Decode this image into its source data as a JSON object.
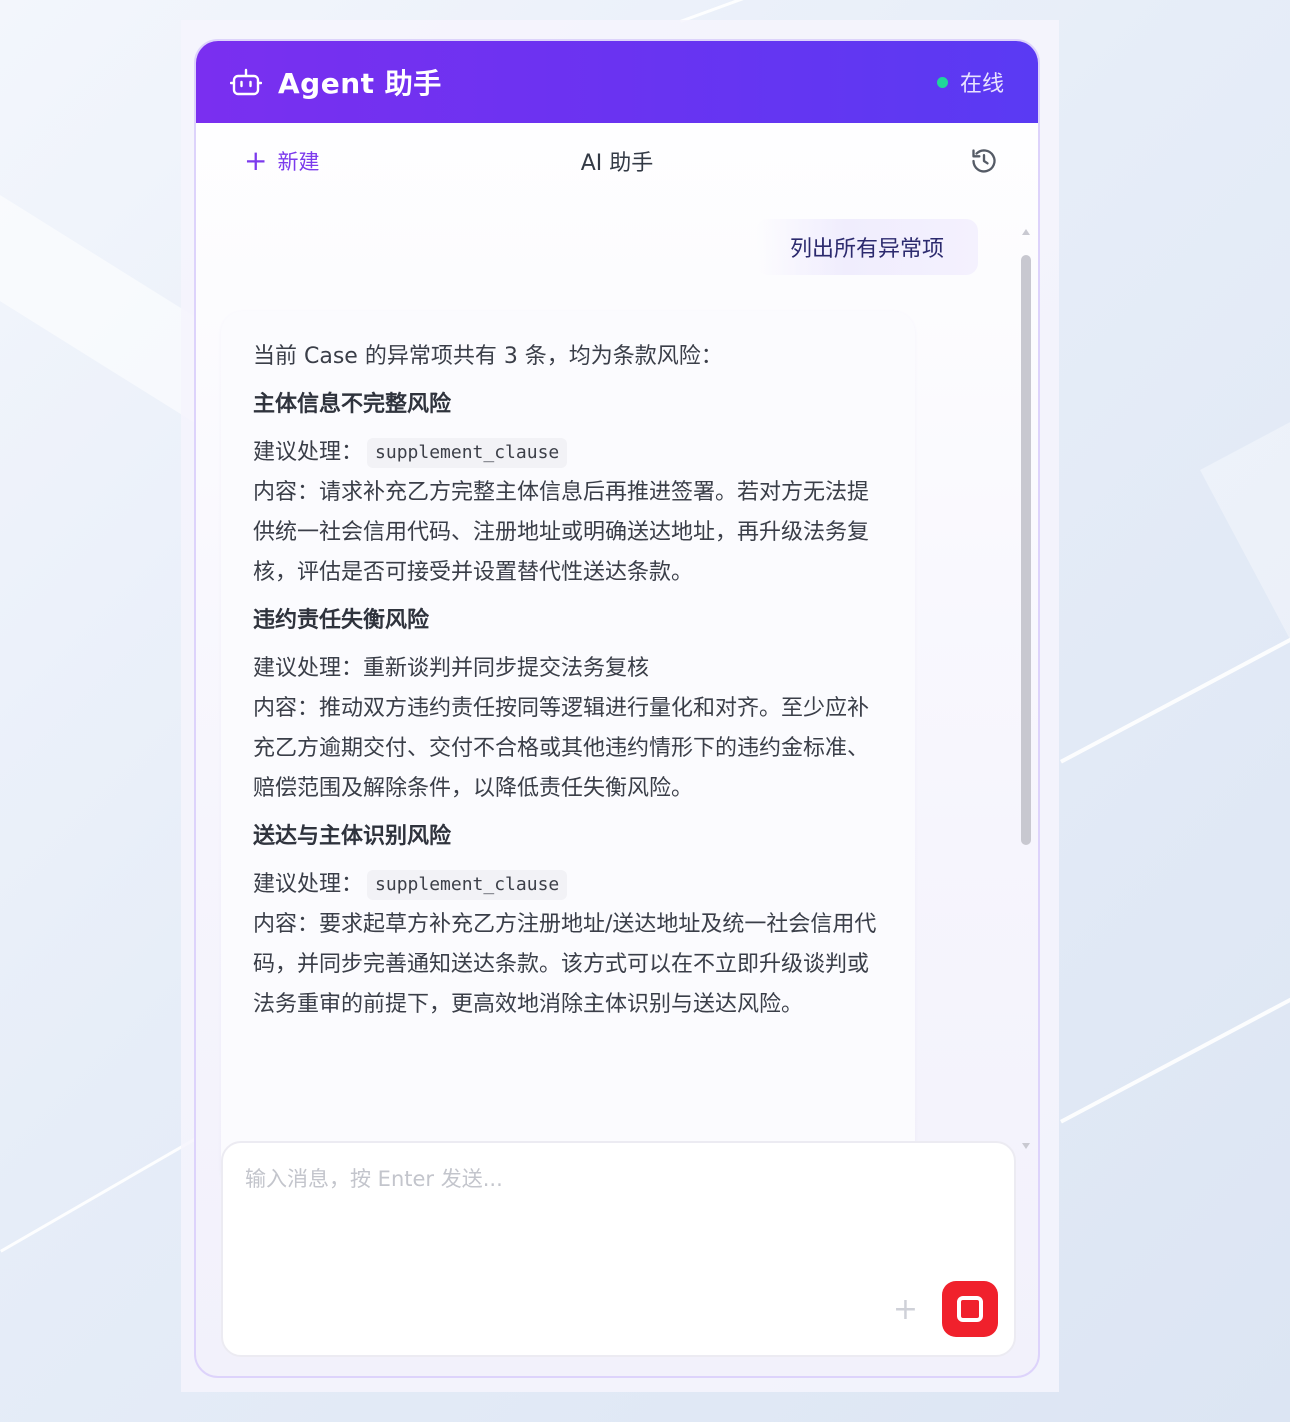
{
  "header": {
    "title": "Agent 助手",
    "status": "在线",
    "status_color": "#20d59a"
  },
  "toolbar": {
    "new_label": "新建",
    "center_title": "AI 助手"
  },
  "user_message": "列出所有异常项",
  "assistant": {
    "intro": "当前 Case 的异常项共有 3 条，均为条款风险：",
    "items": [
      {
        "title": "主体信息不完整风险",
        "suggest_label": "建议处理：",
        "suggest_code": "supplement_clause",
        "suggest_text": "",
        "content": "内容：请求补充乙方完整主体信息后再推进签署。若对方无法提供统一社会信用代码、注册地址或明确送达地址，再升级法务复核，评估是否可接受并设置替代性送达条款。"
      },
      {
        "title": "违约责任失衡风险",
        "suggest_label": "建议处理：",
        "suggest_code": "",
        "suggest_text": "重新谈判并同步提交法务复核",
        "content": "内容：推动双方违约责任按同等逻辑进行量化和对齐。至少应补充乙方逾期交付、交付不合格或其他违约情形下的违约金标准、赔偿范围及解除条件，以降低责任失衡风险。"
      },
      {
        "title": "送达与主体识别风险",
        "suggest_label": "建议处理：",
        "suggest_code": "supplement_clause",
        "suggest_text": "",
        "content": "内容：要求起草方补充乙方注册地址/送达地址及统一社会信用代码，并同步完善通知送达条款。该方式可以在不立即升级谈判或法务重审的前提下，更高效地消除主体识别与送达风险。"
      }
    ]
  },
  "composer": {
    "placeholder": "输入消息，按 Enter 发送...",
    "stop_color": "#f0212c"
  },
  "colors": {
    "header_start": "#7a2ff0",
    "header_end": "#5a3af3",
    "accent": "#7c3aed"
  }
}
